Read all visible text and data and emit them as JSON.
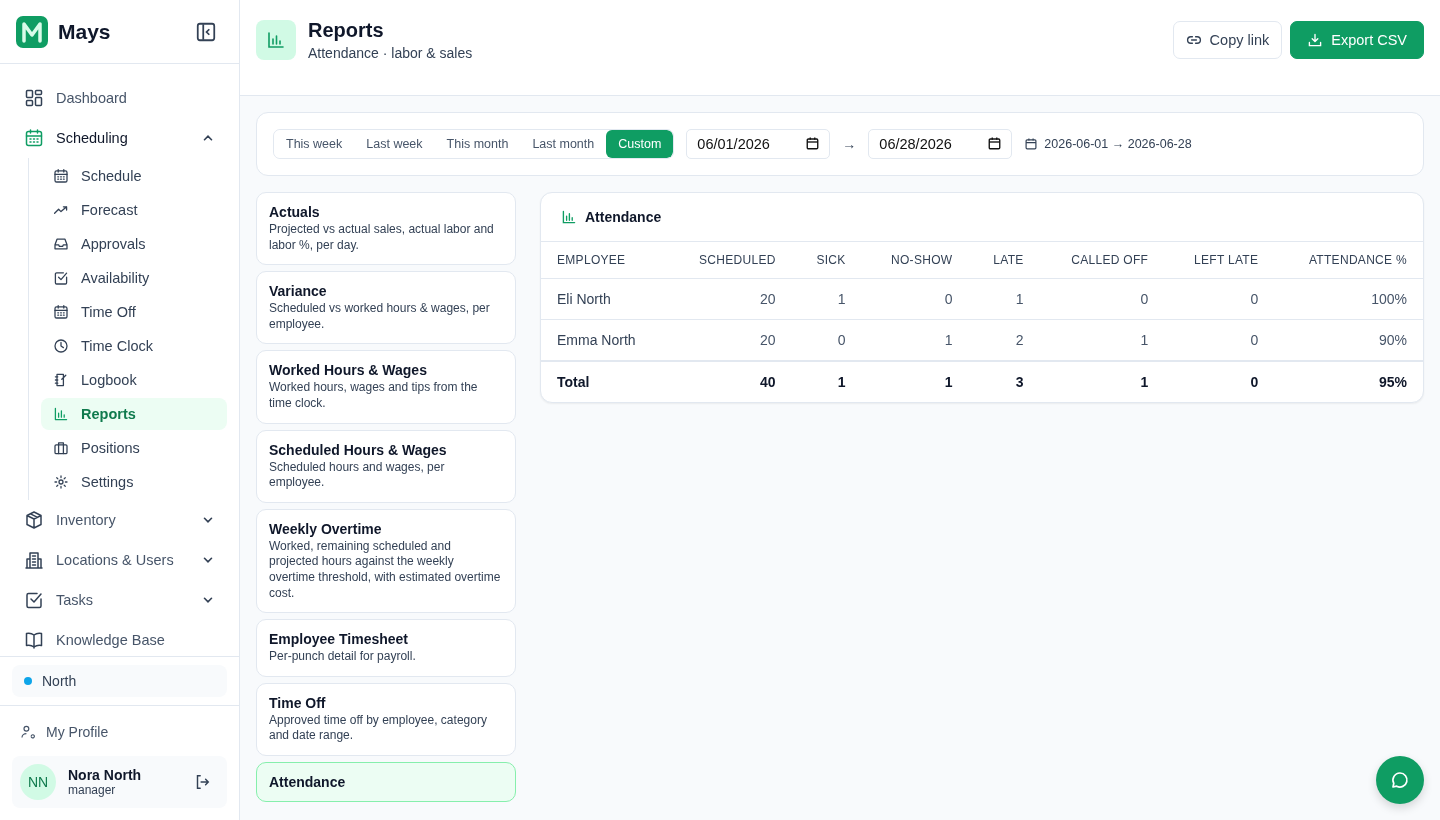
{
  "brand": {
    "name": "Mays"
  },
  "nav": [
    {
      "label": "Dashboard",
      "kind": "link",
      "selected": false
    },
    {
      "label": "Scheduling",
      "kind": "group",
      "expanded": true,
      "children": [
        {
          "label": "Schedule",
          "selected": false
        },
        {
          "label": "Forecast",
          "selected": false
        },
        {
          "label": "Approvals",
          "selected": false
        },
        {
          "label": "Availability",
          "selected": false
        },
        {
          "label": "Time Off",
          "selected": false
        },
        {
          "label": "Time Clock",
          "selected": false
        },
        {
          "label": "Logbook",
          "selected": false
        },
        {
          "label": "Reports",
          "selected": true
        },
        {
          "label": "Positions",
          "selected": false
        },
        {
          "label": "Settings",
          "selected": false
        }
      ]
    },
    {
      "label": "Inventory",
      "kind": "group",
      "expanded": false
    },
    {
      "label": "Locations & Users",
      "kind": "group",
      "expanded": false
    },
    {
      "label": "Tasks",
      "kind": "group",
      "expanded": false
    },
    {
      "label": "Knowledge Base",
      "kind": "link",
      "selected": false
    }
  ],
  "location": {
    "name": "North",
    "color": "#0ea5e9"
  },
  "profile": {
    "link": "My Profile",
    "initials": "NN",
    "name": "Nora North",
    "role": "manager"
  },
  "header": {
    "title": "Reports",
    "subtitle": "Attendance · labor & sales",
    "buttons": [
      {
        "label": "Copy link",
        "kind": "secondary"
      },
      {
        "label": "Export CSV",
        "kind": "primary"
      }
    ]
  },
  "filters": {
    "ranges": [
      {
        "label": "This week",
        "selected": false
      },
      {
        "label": "Last week",
        "selected": false
      },
      {
        "label": "This month",
        "selected": false
      },
      {
        "label": "Last month",
        "selected": false
      },
      {
        "label": "Custom",
        "selected": true
      }
    ],
    "from": "06/01/2026",
    "arrow": "→",
    "to": "06/28/2026",
    "summary": "2026-06-01 → 2026-06-28"
  },
  "reports": [
    {
      "title": "Actuals",
      "description": "Projected vs actual sales, actual labor and labor %, per day.",
      "selected": false
    },
    {
      "title": "Variance",
      "description": "Scheduled vs worked hours & wages, per employee.",
      "selected": false
    },
    {
      "title": "Worked Hours & Wages",
      "description": "Worked hours, wages and tips from the time clock.",
      "selected": false
    },
    {
      "title": "Scheduled Hours & Wages",
      "description": "Scheduled hours and wages, per employee.",
      "selected": false
    },
    {
      "title": "Weekly Overtime",
      "description": "Worked, remaining scheduled and projected hours against the weekly overtime threshold, with estimated overtime cost.",
      "selected": false
    },
    {
      "title": "Employee Timesheet",
      "description": "Per-punch detail for payroll.",
      "selected": false
    },
    {
      "title": "Time Off",
      "description": "Approved time off by employee, category and date range.",
      "selected": false
    },
    {
      "title": "Attendance",
      "selected": true
    }
  ],
  "table": {
    "title": "Attendance",
    "columns": [
      "EMPLOYEE",
      "SCHEDULED",
      "SICK",
      "NO-SHOW",
      "LATE",
      "CALLED OFF",
      "LEFT LATE",
      "ATTENDANCE %"
    ],
    "rows": [
      [
        "Eli North",
        "20",
        "1",
        "0",
        "1",
        "0",
        "0",
        "100%"
      ],
      [
        "Emma North",
        "20",
        "0",
        "1",
        "2",
        "1",
        "0",
        "90%"
      ]
    ],
    "total": [
      "Total",
      "40",
      "1",
      "1",
      "3",
      "1",
      "0",
      "95%"
    ]
  }
}
